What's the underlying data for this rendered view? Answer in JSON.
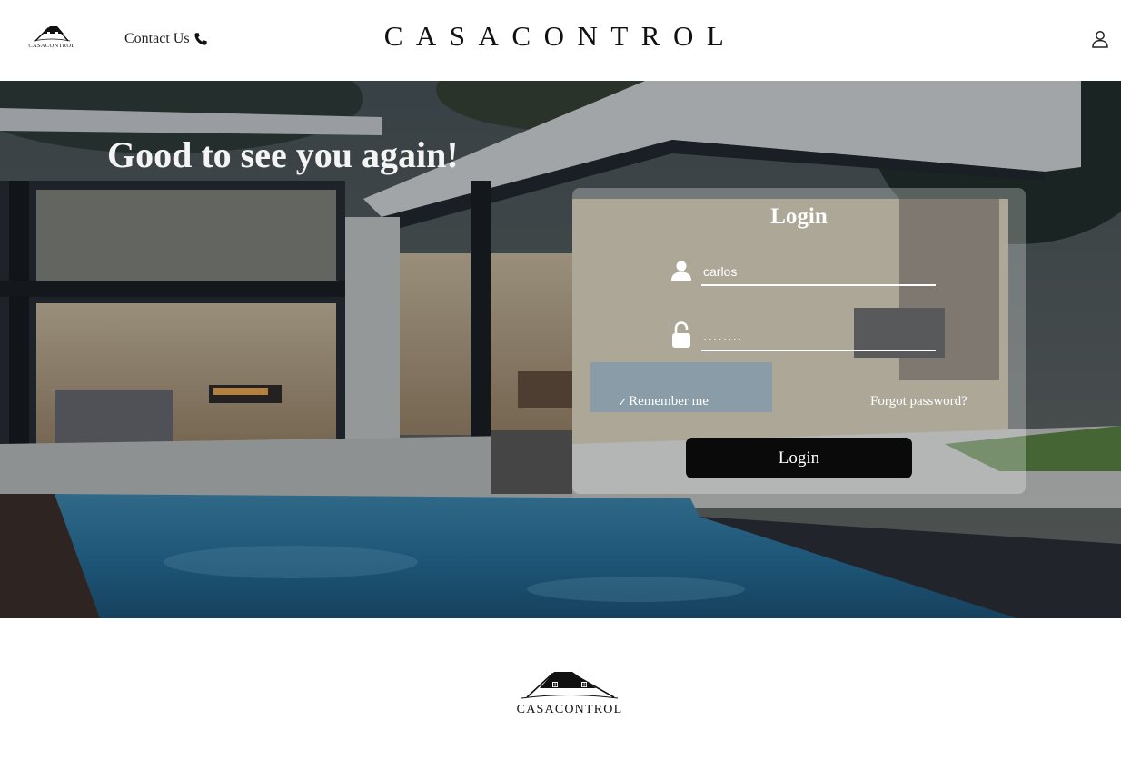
{
  "header": {
    "logo_text": "CASACONTROL",
    "contact_label": "Contact Us",
    "brand_title": "CASACONTROL"
  },
  "hero": {
    "greeting": "Good to see you again!"
  },
  "login": {
    "title": "Login",
    "username_value": "carlos",
    "password_value": "........",
    "remember_label": "Remember me",
    "remember_checked": true,
    "forgot_label": "Forgot password?",
    "submit_label": "Login"
  },
  "footer": {
    "logo_text": "CASACONTROL"
  },
  "icons": {
    "contact": "phone-icon",
    "user_menu": "user-icon",
    "username_field": "user-icon",
    "password_field": "lock-icon",
    "remember": "checkmark-icon"
  },
  "colors": {
    "button_bg": "#0a0a0a",
    "card_bg": "rgba(255,255,255,0.28)",
    "text_light": "#ffffff",
    "text_dark": "#111111"
  }
}
